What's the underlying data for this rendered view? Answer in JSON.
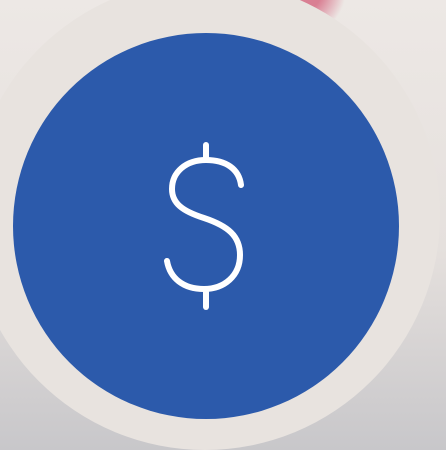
{
  "colors": {
    "background": "#ece8e5",
    "outer_disc": "#e8e3df",
    "coin_fill": "#2c5aab",
    "icon": "#ffffff",
    "accent_pink": "#d97f93"
  },
  "icon": {
    "name": "dollar-icon"
  }
}
